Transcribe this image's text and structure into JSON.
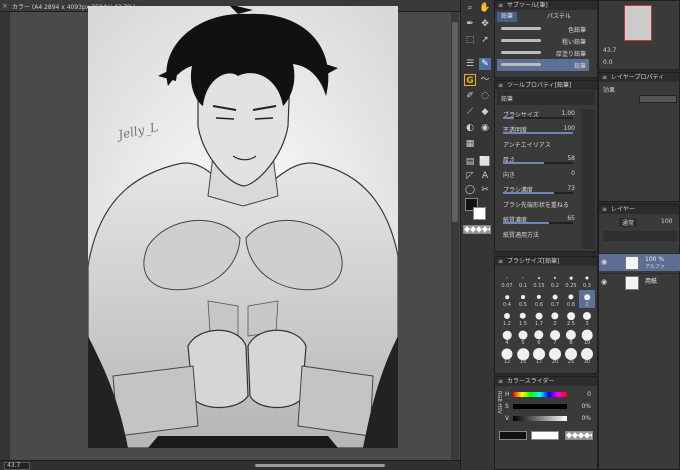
{
  "document": {
    "tab_close": "×",
    "title": "カラー (A4 2894 x 4093px 350dpi 43.7%)",
    "signature_text": "Jelly_L"
  },
  "status": {
    "zoom": "43.7"
  },
  "tools": {
    "icons": [
      "zoom-icon",
      "hand-icon",
      "pen-icon",
      "move-icon",
      "select-icon",
      "layer-move-icon",
      "eyedropper-icon",
      "brush-icon",
      "lasso-icon",
      "wand-icon",
      "eraser-icon",
      "fill-icon",
      "gradient-icon",
      "shape-icon",
      "text-icon",
      "ruler-icon",
      "balloon-icon",
      "rotate-icon",
      "blend-icon",
      "figure-icon"
    ],
    "g_label": "G"
  },
  "subtool": {
    "title": "サブツール[筆]",
    "tab_active": "鉛筆",
    "tab_other": "パステル",
    "items": [
      "色鉛筆",
      "粗い鉛筆",
      "厚塗り鉛筆",
      "鉛筆"
    ]
  },
  "tool_property": {
    "title": "ツールプロパティ[鉛筆]",
    "name": "鉛筆",
    "rows": [
      {
        "label": "ブラシサイズ",
        "value": "1.00",
        "fill": 0.15
      },
      {
        "label": "不透明度",
        "value": "100",
        "fill": 1.0
      },
      {
        "label": "アンチエイリアス",
        "value": "",
        "fill": 0
      },
      {
        "label": "厚さ",
        "value": "58",
        "fill": 0.58
      },
      {
        "label": "向き",
        "value": "0",
        "fill": 0.0
      },
      {
        "label": "ブラシ濃度",
        "value": "73",
        "fill": 0.73
      },
      {
        "label": "ブラシ先端形状を重ねる",
        "value": "",
        "fill": 0
      },
      {
        "label": "紙質濃度",
        "value": "65",
        "fill": 0.65
      },
      {
        "label": "紙質適用方法",
        "value": "",
        "fill": 0
      }
    ]
  },
  "brush_size": {
    "title": "ブラシサイズ[鉛筆]",
    "sizes": [
      "0.07",
      "0.1",
      "0.15",
      "0.2",
      "0.25",
      "0.3",
      "0.4",
      "0.5",
      "0.6",
      "0.7",
      "0.8",
      "1",
      "1.2",
      "1.5",
      "1.7",
      "2",
      "2.5",
      "3",
      "4",
      "5",
      "6",
      "7",
      "8",
      "10",
      "12",
      "15",
      "17",
      "20",
      "25",
      "30"
    ]
  },
  "color_slider": {
    "title": "カラースライダー",
    "side_labels": "RGB HSV",
    "h": "0",
    "s": "0%",
    "v": "0%"
  },
  "navigator": {
    "zoom": "43.7",
    "angle": "0.0"
  },
  "layer_property": {
    "title": "レイヤープロパティ",
    "effect_label": "効果"
  },
  "layers": {
    "title": "レイヤー",
    "blend": "通常",
    "opacity": "100",
    "rows": [
      {
        "name": "100 %",
        "sub": "アルファ"
      },
      {
        "name": "用紙",
        "sub": ""
      }
    ]
  },
  "colors": {
    "accent": "#4f6fa5",
    "panel": "#3a3a3a",
    "selected_row": "#5c6e93"
  }
}
